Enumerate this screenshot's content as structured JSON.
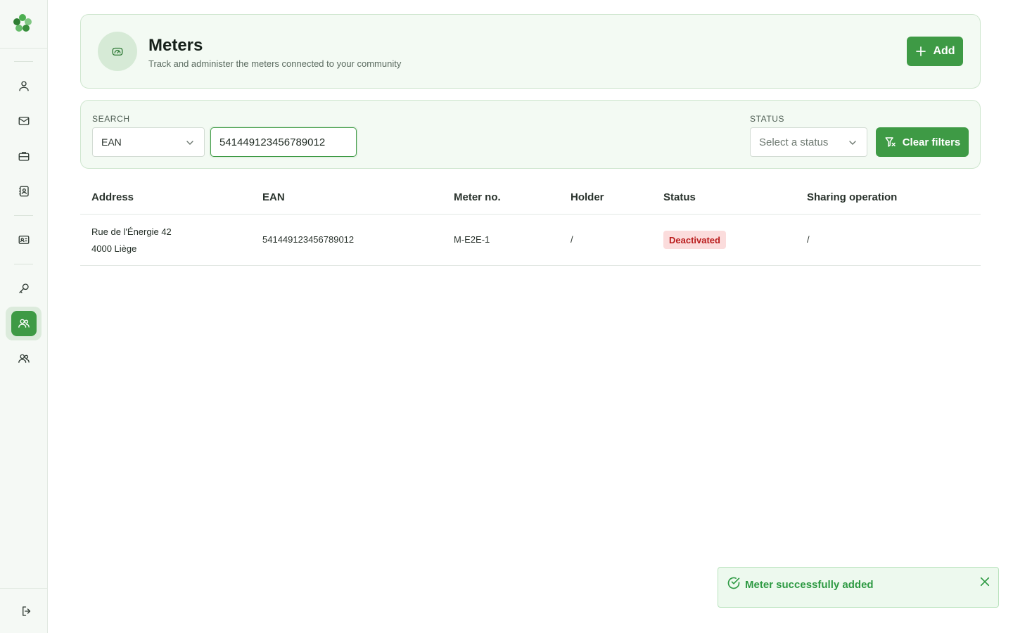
{
  "sidebar": {
    "items": [
      {
        "icon": "user-icon"
      },
      {
        "icon": "mail-icon"
      },
      {
        "icon": "briefcase-icon"
      },
      {
        "icon": "contact-book-icon"
      },
      {
        "icon": "id-card-icon"
      },
      {
        "icon": "key-icon"
      },
      {
        "icon": "users-icon",
        "active": true
      },
      {
        "icon": "users-icon"
      }
    ],
    "logout_icon": "logout-icon"
  },
  "header": {
    "icon": "gauge-icon",
    "title": "Meters",
    "subtitle": "Track and administer the meters connected to your community",
    "add_label": "Add"
  },
  "filters": {
    "search_label": "SEARCH",
    "search_field": "EAN",
    "search_value": "541449123456789012",
    "status_label": "STATUS",
    "status_placeholder": "Select a status",
    "clear_label": "Clear filters"
  },
  "table": {
    "columns": [
      "Address",
      "EAN",
      "Meter no.",
      "Holder",
      "Status",
      "Sharing operation"
    ],
    "rows": [
      {
        "address_line1": "Rue de l'Énergie 42",
        "address_line2": "4000 Liège",
        "ean": "541449123456789012",
        "meter_no": "M-E2E-1",
        "holder": "/",
        "status": "Deactivated",
        "sharing_operation": "/"
      }
    ]
  },
  "toast": {
    "message": "Meter successfully added"
  },
  "colors": {
    "primary": "#3e9a45",
    "status_deactivated_bg": "#fbdcdc",
    "status_deactivated_text": "#b91c1c",
    "toast_text": "#2e9a43"
  }
}
